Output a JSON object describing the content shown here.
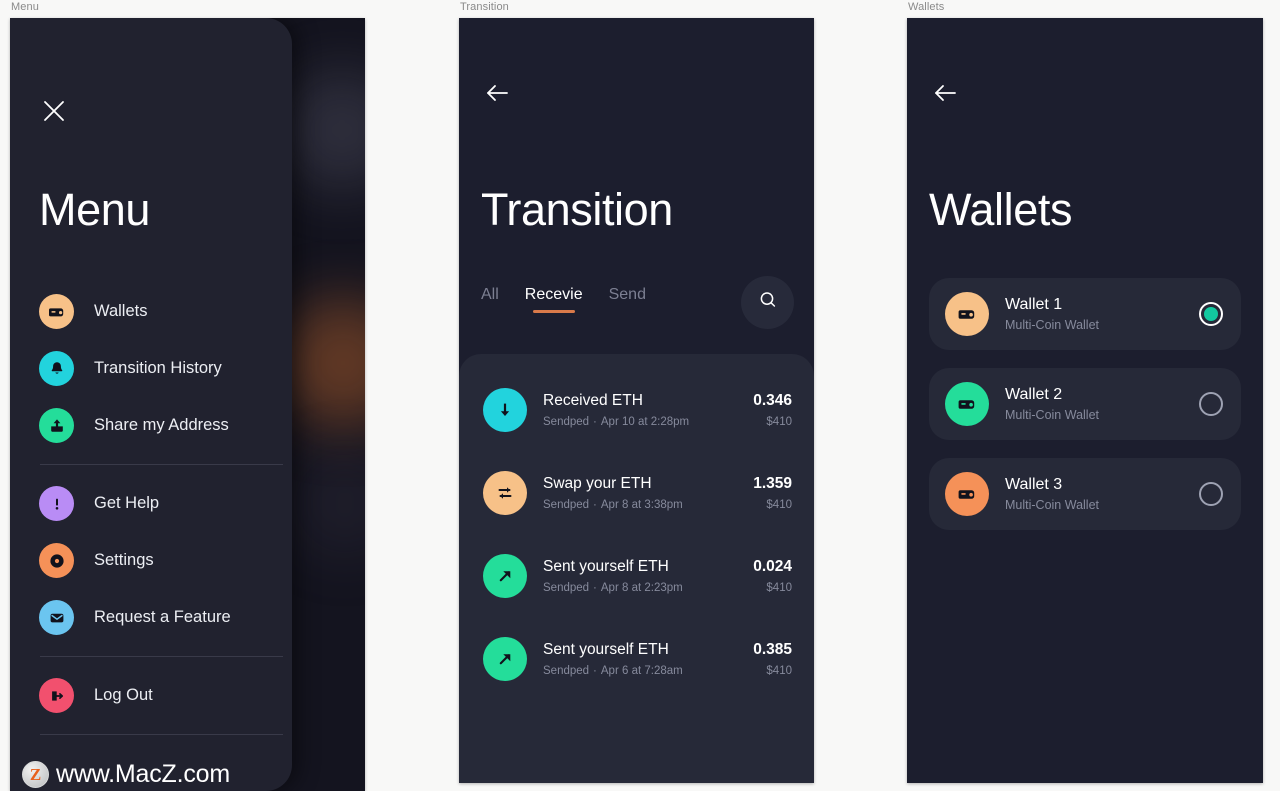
{
  "captions": {
    "menu": "Menu",
    "transition": "Transition",
    "wallets": "Wallets"
  },
  "colors": {
    "page_bg": "#f8f8f7",
    "panel_bg": "#1c1e2e",
    "drawer_bg": "#21222f",
    "card_bg": "#262938",
    "accent_orange": "#d97a4a",
    "accent_teal": "#12c9a0",
    "text_primary": "#ffffff",
    "text_muted": "#868a9c"
  },
  "menu_screen": {
    "close_icon": "close-icon",
    "title": "Menu",
    "groups": [
      {
        "items": [
          {
            "label": "Wallets",
            "icon": "wallet-icon",
            "color": "#f7c188"
          },
          {
            "label": "Transition History",
            "icon": "bell-icon",
            "color": "#22d3dd"
          },
          {
            "label": "Share my Address",
            "icon": "share-upload-icon",
            "color": "#24dd9a"
          }
        ]
      },
      {
        "items": [
          {
            "label": "Get Help",
            "icon": "exclamation-icon",
            "color": "#b98cf5"
          },
          {
            "label": "Settings",
            "icon": "gear-icon",
            "color": "#f59158"
          },
          {
            "label": "Request a Feature",
            "icon": "envelope-icon",
            "color": "#6bc5f0"
          }
        ]
      },
      {
        "items": [
          {
            "label": "Log Out",
            "icon": "logout-icon",
            "color": "#f2506e"
          }
        ]
      }
    ],
    "watermark": {
      "badge": "Z",
      "text": "www.MacZ.com"
    }
  },
  "transition_screen": {
    "back_icon": "arrow-left-icon",
    "title": "Transition",
    "tabs": [
      {
        "label": "All",
        "active": false
      },
      {
        "label": "Recevie",
        "active": true
      },
      {
        "label": "Send",
        "active": false
      }
    ],
    "search_icon": "search-icon",
    "transactions": [
      {
        "icon": "arrow-down-icon",
        "color": "#22d3dd",
        "name": "Received ETH",
        "status": "Sendped",
        "date": "Apr 10 at 2:28pm",
        "amount": "0.346",
        "fiat": "$410"
      },
      {
        "icon": "swap-icon",
        "color": "#f7c188",
        "name": "Swap your ETH",
        "status": "Sendped",
        "date": "Apr 8 at 3:38pm",
        "amount": "1.359",
        "fiat": "$410"
      },
      {
        "icon": "arrow-up-right-icon",
        "color": "#24dd9a",
        "name": "Sent yourself ETH",
        "status": "Sendped",
        "date": "Apr 8 at 2:23pm",
        "amount": "0.024",
        "fiat": "$410"
      },
      {
        "icon": "arrow-up-right-icon",
        "color": "#24dd9a",
        "name": "Sent yourself ETH",
        "status": "Sendped",
        "date": "Apr 6 at 7:28am",
        "amount": "0.385",
        "fiat": "$410"
      }
    ]
  },
  "wallets_screen": {
    "back_icon": "arrow-left-icon",
    "title": "Wallets",
    "wallets": [
      {
        "name": "Wallet 1",
        "subtitle": "Multi-Coin Wallet",
        "color": "#f7c188",
        "selected": true
      },
      {
        "name": "Wallet 2",
        "subtitle": "Multi-Coin Wallet",
        "color": "#24dd9a",
        "selected": false
      },
      {
        "name": "Wallet 3",
        "subtitle": "Multi-Coin Wallet",
        "color": "#f59158",
        "selected": false
      }
    ]
  }
}
